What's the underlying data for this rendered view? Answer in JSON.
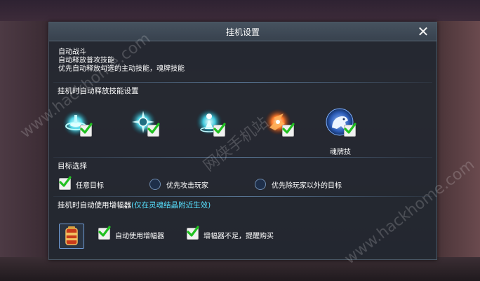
{
  "dialog": {
    "title": "挂机设置",
    "close_glyph": "✕"
  },
  "info": [
    "自动战斗",
    "自动释放普攻技能",
    "优先自动释放勾选的主动技能，魂牌技能"
  ],
  "skills_section": {
    "title": "挂机时自动释放技能设置",
    "skills": [
      {
        "icon": "spinning-disc-icon",
        "checked": true,
        "label": ""
      },
      {
        "icon": "star-burst-icon",
        "checked": true,
        "label": ""
      },
      {
        "icon": "figure-glow-icon",
        "checked": true,
        "label": ""
      },
      {
        "icon": "fire-burst-icon",
        "checked": true,
        "label": ""
      },
      {
        "icon": "soul-beast-icon",
        "checked": true,
        "label": "魂牌技"
      }
    ]
  },
  "target_section": {
    "title": "目标选择",
    "options": [
      {
        "label": "任意目标",
        "selected": true
      },
      {
        "label": "优先攻击玩家",
        "selected": false
      },
      {
        "label": "优先除玩家以外的目标",
        "selected": false
      }
    ]
  },
  "booster_section": {
    "title": "挂机时自动使用增幅器",
    "note": "(仅在灵魂结晶附近生效)",
    "item_icon": "booster-canister-icon",
    "options": [
      {
        "label": "自动使用增幅器",
        "checked": true
      },
      {
        "label": "增幅器不足，提醒购买",
        "checked": true
      }
    ]
  },
  "watermarks": [
    "www.hackhome.com",
    "网侠手机站",
    "www.hackhome.com"
  ],
  "colors": {
    "accent": "#57e0ff",
    "check": "#20c020",
    "panel": "#222830"
  }
}
